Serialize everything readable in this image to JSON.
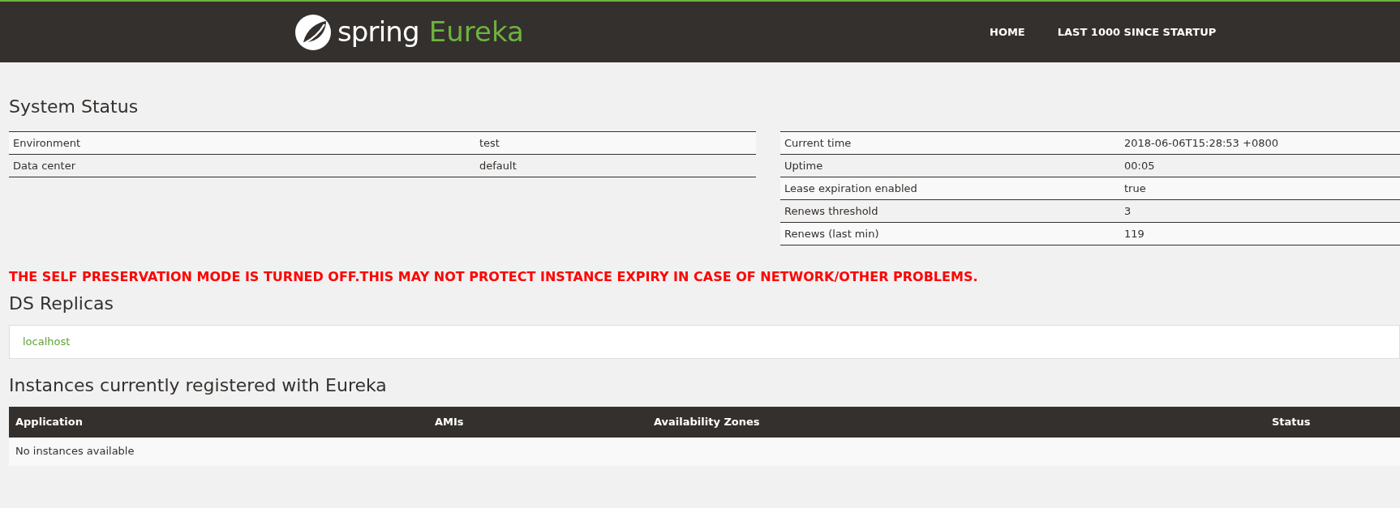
{
  "header": {
    "logo_word": "spring",
    "logo_product": "Eureka",
    "nav": [
      "HOME",
      "LAST 1000 SINCE STARTUP"
    ]
  },
  "system_status": {
    "title": "System Status",
    "left_rows": [
      {
        "label": "Environment",
        "value": "test"
      },
      {
        "label": "Data center",
        "value": "default"
      }
    ],
    "right_rows": [
      {
        "label": "Current time",
        "value": "2018-06-06T15:28:53 +0800"
      },
      {
        "label": "Uptime",
        "value": "00:05"
      },
      {
        "label": "Lease expiration enabled",
        "value": "true"
      },
      {
        "label": "Renews threshold",
        "value": "3"
      },
      {
        "label": "Renews (last min)",
        "value": "119"
      }
    ]
  },
  "warning": "THE SELF PRESERVATION MODE IS TURNED OFF.THIS MAY NOT PROTECT INSTANCE EXPIRY IN CASE OF NETWORK/OTHER PROBLEMS.",
  "ds_replicas": {
    "title": "DS Replicas",
    "items": [
      "localhost"
    ]
  },
  "instances": {
    "title": "Instances currently registered with Eureka",
    "columns": [
      "Application",
      "AMIs",
      "Availability Zones",
      "Status"
    ],
    "empty": "No instances available"
  }
}
